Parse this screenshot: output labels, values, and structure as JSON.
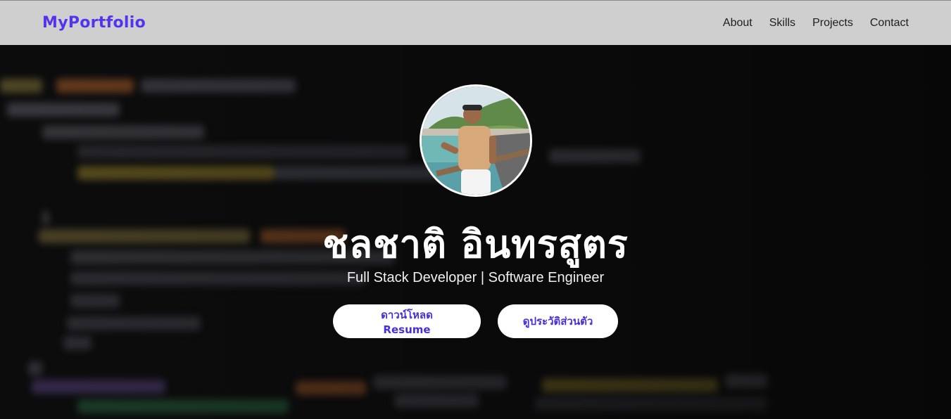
{
  "navbar": {
    "brand": "MyPortfolio",
    "links": [
      {
        "label": "About"
      },
      {
        "label": "Skills"
      },
      {
        "label": "Projects"
      },
      {
        "label": "Contact"
      }
    ]
  },
  "hero": {
    "avatar_icon": "profile-photo",
    "name": "ชลชาติ อินทรสูตร",
    "subtitle": "Full Stack Developer | Software Engineer",
    "buttons": {
      "download_resume": "ดาวน์โหลด Resume",
      "view_profile": "ดูประวัติส่วนตัว"
    }
  },
  "colors": {
    "brand": "#5533ee",
    "navbar_bg": "#cfcfcf",
    "button_text": "#4b2fd6",
    "hero_bg": "#0d0d0e"
  }
}
